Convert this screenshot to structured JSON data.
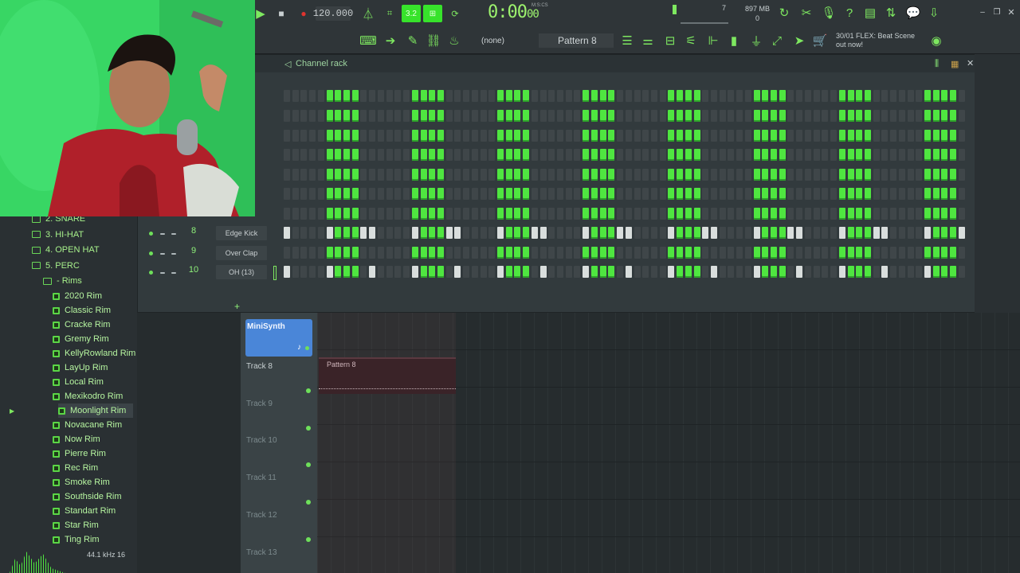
{
  "transport": {
    "tempo": "120.000",
    "time": "0:00",
    "time_fraction": "00",
    "time_label": "M:S:CS",
    "snap": "(none)",
    "pattern": "Pattern 8",
    "memory": "897 MB",
    "memory_sub": "0",
    "cpu": "7",
    "hint_top": "30/01  FLEX: Beat Scene",
    "hint_bottom": "out now!"
  },
  "channel_rack": {
    "title": "Channel rack",
    "channels": [
      {
        "num": "",
        "name": "",
        "pattern": "full"
      },
      {
        "num": "",
        "name": "",
        "pattern": "full"
      },
      {
        "num": "",
        "name": "",
        "pattern": "full"
      },
      {
        "num": "",
        "name": "",
        "pattern": "full"
      },
      {
        "num": "",
        "name": "",
        "pattern": "full"
      },
      {
        "num": "",
        "name": "",
        "pattern": "full"
      },
      {
        "num": "",
        "name": "",
        "pattern": "full"
      },
      {
        "num": "8",
        "name": "Edge Kick",
        "pattern": "mixed"
      },
      {
        "num": "9",
        "name": "Over Clap",
        "pattern": "full"
      },
      {
        "num": "10",
        "name": "OH (13)",
        "pattern": "mixed"
      }
    ]
  },
  "browser": {
    "folders": [
      {
        "label": "2. SNARE"
      },
      {
        "label": "3. HI-HAT"
      },
      {
        "label": "4. OPEN HAT"
      },
      {
        "label": "5. PERC"
      },
      {
        "label": "- Rims"
      }
    ],
    "items": [
      "2020 Rim",
      "Classic Rim",
      "Cracke Rim",
      "Gremy Rim",
      "KellyRowland Rim",
      "LayUp Rim",
      "Local Rim",
      "Mexikodro Rim",
      "Moonlight Rim",
      "Novacane Rim",
      "Now Rim",
      "Pierre Rim",
      "Rec Rim",
      "Smoke Rim",
      "Southside Rim",
      "Standart Rim",
      "Star Rim",
      "Ting Rim"
    ],
    "selected_index": 8,
    "sample_rate": "44.1 kHz 16"
  },
  "playlist": {
    "minisynth": "MiniSynth",
    "pattern_clip": "Pattern 8",
    "tracks": [
      "Track 8",
      "Track 9",
      "Track 10",
      "Track 11",
      "Track 12",
      "Track 13"
    ]
  }
}
